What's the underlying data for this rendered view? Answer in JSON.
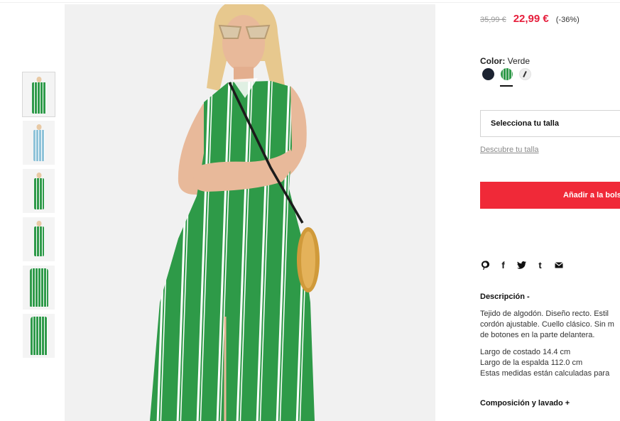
{
  "gallery": {
    "thumbnails": [
      {
        "alt": "thumb-1"
      },
      {
        "alt": "thumb-2"
      },
      {
        "alt": "thumb-3"
      },
      {
        "alt": "thumb-4"
      },
      {
        "alt": "thumb-5"
      },
      {
        "alt": "thumb-6"
      }
    ]
  },
  "price": {
    "old": "35,99 €",
    "current": "22,99 €",
    "discount": "(-36%)",
    "current_color": "#e61e3c"
  },
  "color": {
    "label": "Color:",
    "value": "Verde",
    "swatches": [
      "navy",
      "green-stripes",
      "white-pattern"
    ],
    "selected": "green-stripes"
  },
  "size": {
    "select_label": "Selecciona tu talla",
    "guide_link": "Descubre tu talla"
  },
  "cart": {
    "add_label": "Añadir a la bols",
    "button_color": "#f02938"
  },
  "share": {
    "icons": [
      "pinterest-icon",
      "facebook-icon",
      "twitter-icon",
      "tumblr-icon",
      "email-icon"
    ],
    "glyphs": [
      "℗",
      "f",
      "🐦",
      "t",
      "✉"
    ]
  },
  "description": {
    "title": "Descripción -",
    "line1": "Tejido de algodón. Diseño recto. Estil",
    "line2": "cordón ajustable. Cuello clásico. Sin m",
    "line3": "de botones en la parte delantera.",
    "measure1": "Largo de costado 14.4 cm",
    "measure2": "Largo de la espalda 112.0 cm",
    "measure3": "Estas medidas están calculadas para"
  },
  "composition": {
    "title": "Composición y lavado +"
  }
}
